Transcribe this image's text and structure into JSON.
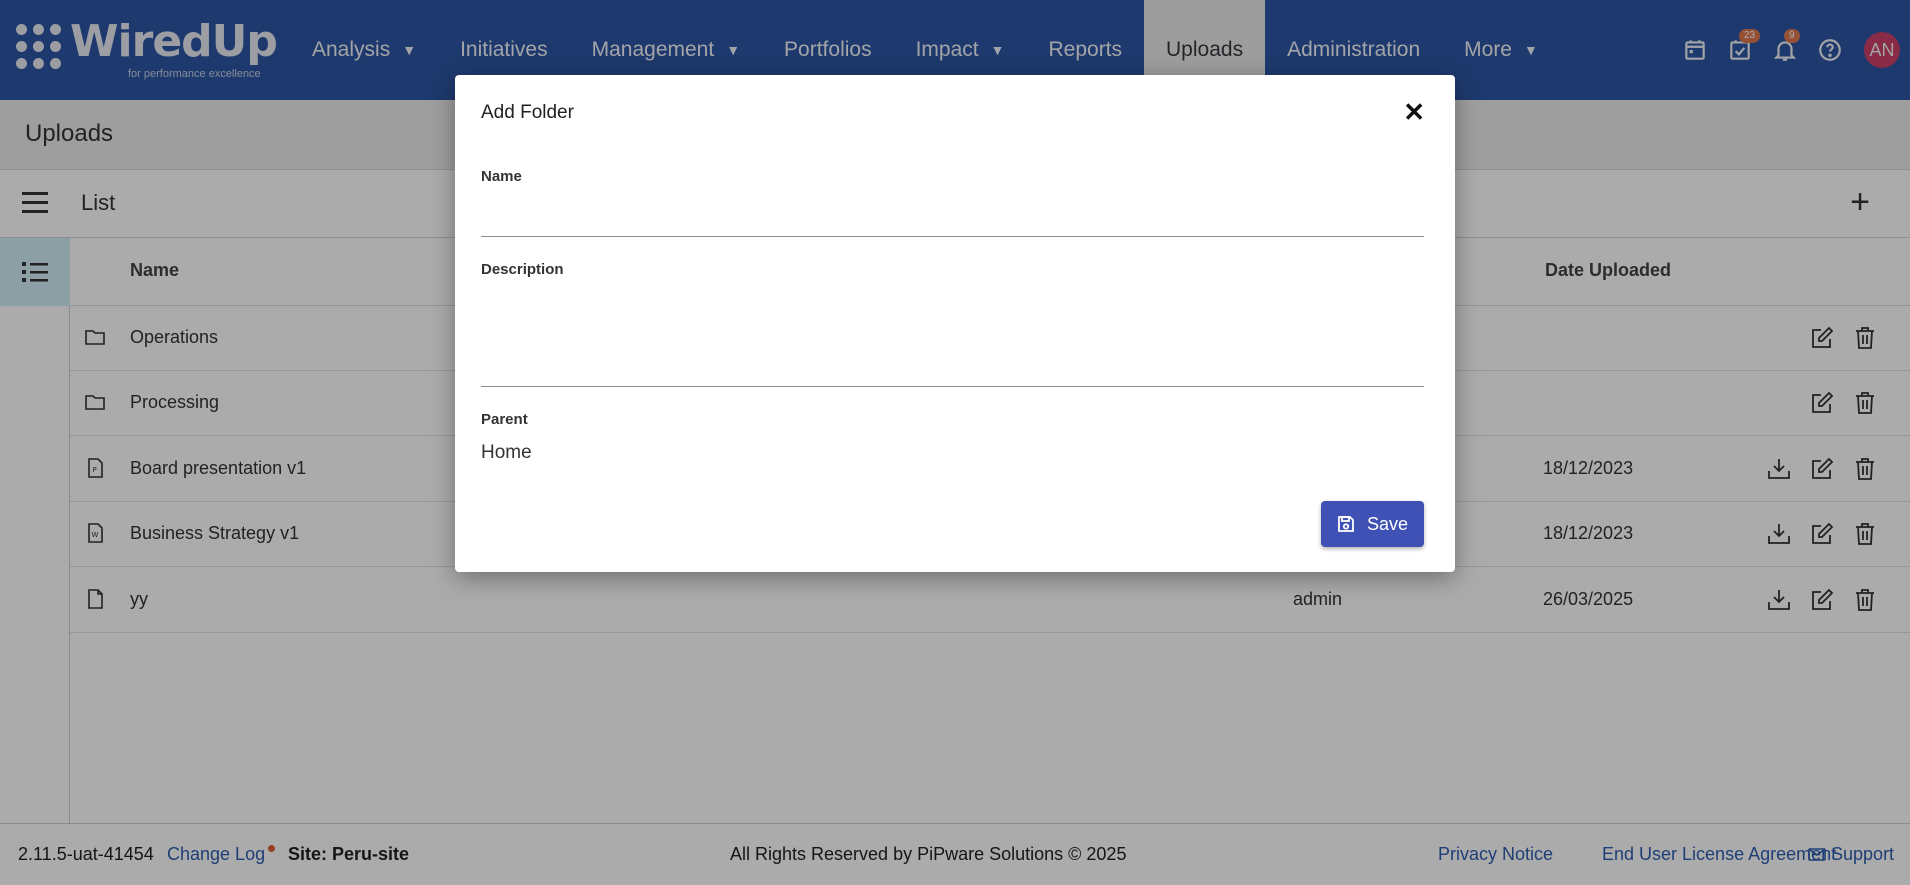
{
  "brand": {
    "name": "WiredUp",
    "tagline": "for performance excellence"
  },
  "nav": {
    "items": [
      {
        "label": "Analysis",
        "dropdown": true
      },
      {
        "label": "Initiatives",
        "dropdown": false
      },
      {
        "label": "Management",
        "dropdown": true
      },
      {
        "label": "Portfolios",
        "dropdown": false
      },
      {
        "label": "Impact",
        "dropdown": true
      },
      {
        "label": "Reports",
        "dropdown": false
      },
      {
        "label": "Uploads",
        "dropdown": false,
        "active": true
      },
      {
        "label": "Administration",
        "dropdown": false
      },
      {
        "label": "More",
        "dropdown": true
      }
    ],
    "icons": {
      "tasks_badge": "23",
      "notifications_badge": "9"
    },
    "avatar_initials": "AN"
  },
  "page": {
    "title": "Uploads",
    "list_label": "List"
  },
  "table": {
    "columns": {
      "name": "Name",
      "date_uploaded": "Date Uploaded"
    },
    "rows": [
      {
        "icon": "folder-icon",
        "name": "Operations",
        "uploaded_by": "",
        "date": "",
        "download": false
      },
      {
        "icon": "folder-icon",
        "name": "Processing",
        "uploaded_by": "",
        "date": "",
        "download": false
      },
      {
        "icon": "powerpoint-file-icon",
        "name": "Board presentation v1",
        "uploaded_by": "",
        "date": "18/12/2023",
        "download": true
      },
      {
        "icon": "word-file-icon",
        "name": "Business Strategy v1",
        "uploaded_by": "",
        "date": "18/12/2023",
        "download": true
      },
      {
        "icon": "file-icon",
        "name": "yy",
        "uploaded_by": "admin",
        "date": "26/03/2025",
        "download": true
      }
    ]
  },
  "footer": {
    "version": "2.11.5-uat-41454",
    "changelog": "Change Log",
    "site": "Site: Peru-site",
    "copyright": "All Rights Reserved by PiPware Solutions © 2025",
    "privacy": "Privacy Notice",
    "eula": "End User License Agreement",
    "support": "Support"
  },
  "modal": {
    "title": "Add Folder",
    "name_label": "Name",
    "name_value": "",
    "description_label": "Description",
    "description_value": "",
    "parent_label": "Parent",
    "parent_value": "Home",
    "save_label": "Save"
  },
  "colors": {
    "navbar": "#2c55a3",
    "primary_button": "#3f51b5",
    "avatar": "#cc3f69",
    "badge": "#e07a50",
    "link": "#2e5fb0"
  }
}
